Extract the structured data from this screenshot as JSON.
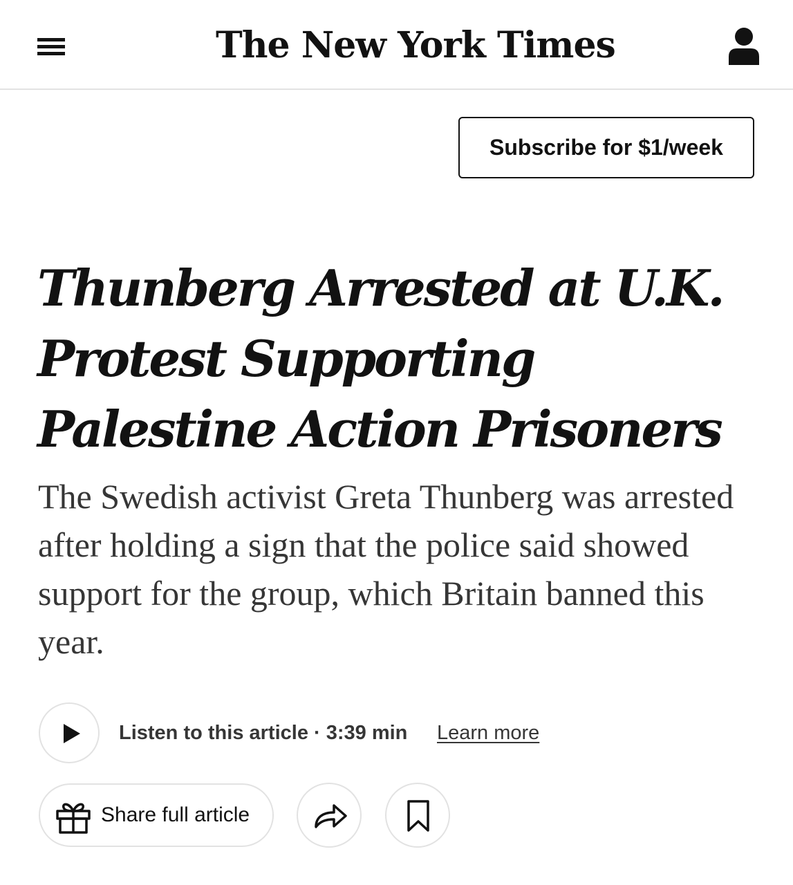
{
  "header": {
    "logo_text": "The New York Times",
    "menu_icon": "hamburger-menu-icon",
    "account_icon": "user-account-icon"
  },
  "subscribe": {
    "label": "Subscribe for $1/week"
  },
  "article": {
    "headline": "Thunberg Arrested at U.K. Protest Supporting Palestine Action Prisoners",
    "summary": "The Swedish activist Greta Thunberg was arrested after holding a sign that the police said showed support for the group, which Britain banned this year."
  },
  "audio": {
    "play_icon": "play-icon",
    "listen_label": "Listen to this article · 3:39 min",
    "learn_more": "Learn more"
  },
  "actions": {
    "share_full_label": "Share full article",
    "gift_icon": "gift-icon",
    "share_icon": "share-arrow-icon",
    "bookmark_icon": "bookmark-icon"
  },
  "colors": {
    "text_primary": "#121212",
    "text_secondary": "#363636",
    "border": "#e2e2e2",
    "background": "#ffffff"
  }
}
